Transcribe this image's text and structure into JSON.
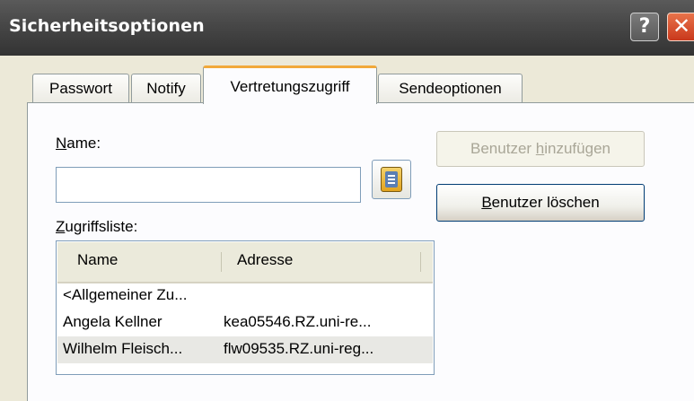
{
  "window": {
    "title": "Sicherheitsoptionen",
    "help_label": "?",
    "close_label": "✕"
  },
  "tabs": [
    {
      "label": "Passwort",
      "active": false
    },
    {
      "label": "Notify",
      "active": false
    },
    {
      "label": "Vertretungszugriff",
      "active": true
    },
    {
      "label": "Sendeoptionen",
      "active": false
    }
  ],
  "form": {
    "name_label_mnemonic": "N",
    "name_label_rest": "ame:",
    "name_value": "",
    "address_book_icon": "address-book-icon",
    "add_button": {
      "pre": "Benutzer ",
      "mnemonic": "h",
      "post": "inzufügen"
    },
    "delete_button": {
      "pre": "",
      "mnemonic": "B",
      "post": "enutzer löschen"
    },
    "access_list_label_mnemonic": "Z",
    "access_list_label_rest": "ugriffsliste:"
  },
  "access_list": {
    "columns": [
      "Name",
      "Adresse"
    ],
    "rows": [
      {
        "name": "<Allgemeiner Zu...",
        "address": ""
      },
      {
        "name": "Angela Kellner",
        "address": "kea05546.RZ.uni-re..."
      },
      {
        "name": "Wilhelm Fleisch...",
        "address": "flw09535.RZ.uni-reg..."
      }
    ]
  }
}
